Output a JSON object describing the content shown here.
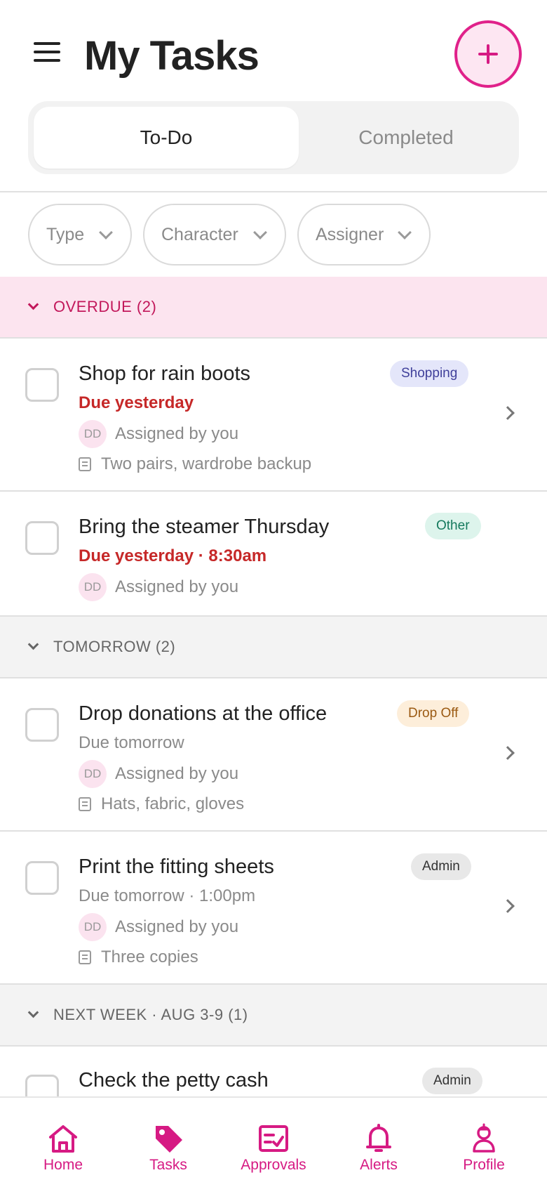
{
  "header": {
    "title": "My Tasks"
  },
  "tabs": [
    {
      "label": "To-Do",
      "active": true
    },
    {
      "label": "Completed",
      "active": false
    }
  ],
  "filters": [
    "Type",
    "Character",
    "Assigner"
  ],
  "sections": {
    "overdue": {
      "label": "OVERDUE (2)"
    },
    "tomorrow": {
      "label": "TOMORROW (2)"
    },
    "next_week": {
      "label": "NEXT WEEK · AUG 3-9 (1)"
    }
  },
  "tasks": [
    {
      "title": "Shop for rain boots",
      "due": "Due yesterday",
      "avatar": "DD",
      "assigned": "Assigned by you",
      "note": "Two pairs, wardrobe backup",
      "badge": "Shopping"
    },
    {
      "title": "Bring the steamer Thursday",
      "due": "Due yesterday · 8:30am",
      "avatar": "DD",
      "assigned": "Assigned by you",
      "badge": "Other"
    },
    {
      "title": "Drop donations at the office",
      "due": "Due tomorrow",
      "avatar": "DD",
      "assigned": "Assigned by you",
      "note": "Hats, fabric, gloves",
      "badge": "Drop Off"
    },
    {
      "title": "Print the fitting sheets",
      "due": "Due tomorrow · 1:00pm",
      "avatar": "DD",
      "assigned": "Assigned by you",
      "note": "Three copies",
      "badge": "Admin"
    },
    {
      "title": "Check the petty cash",
      "badge": "Admin"
    }
  ],
  "nav": [
    {
      "label": "Home",
      "icon": "home-icon"
    },
    {
      "label": "Tasks",
      "icon": "tag-icon",
      "active": true
    },
    {
      "label": "Approvals",
      "icon": "approvals-icon"
    },
    {
      "label": "Alerts",
      "icon": "bell-icon"
    },
    {
      "label": "Profile",
      "icon": "profile-icon"
    }
  ],
  "colors": {
    "accent": "#d61a83",
    "overdue_bg": "#fce4ef",
    "overdue_text": "#c2185b",
    "due_red": "#c62828"
  }
}
